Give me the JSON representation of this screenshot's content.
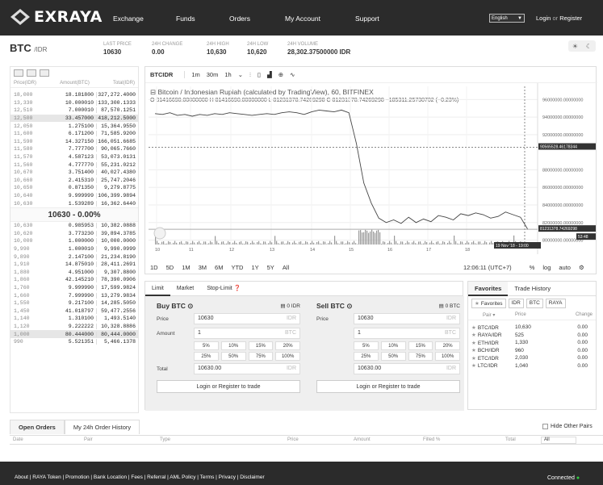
{
  "brand": {
    "name": "EXRAYA"
  },
  "nav": {
    "items": [
      "Exchange",
      "Funds",
      "Orders",
      "My Account",
      "Support"
    ],
    "language": "English",
    "login": "Login",
    "or": "or",
    "register": "Register"
  },
  "ticker": {
    "pair": "BTC",
    "quote": "/IDR",
    "last_label": "LAST PRICE",
    "last": "10630",
    "change_label": "24H CHANGE",
    "change": "0.00",
    "high_label": "24H HIGH",
    "high": "10,630",
    "low_label": "24H LOW",
    "low": "10,620",
    "volume_label": "24H VOLUME",
    "volume": "28,302.37500000 IDR"
  },
  "orderbook": {
    "headers": [
      "Price(IDR)",
      "Amount(BTC)",
      "Total(IDR)"
    ],
    "asks": [
      [
        "18,000",
        "18.181800",
        "327,272.4000"
      ],
      [
        "13,330",
        "10.000010",
        "133,300.1333"
      ],
      [
        "12,510",
        "7.000010",
        "87,570.1251"
      ],
      [
        "12,500",
        "33.457000",
        "418,212.5000"
      ],
      [
        "12,050",
        "1.275100",
        "15,364.9550"
      ],
      [
        "11,600",
        "6.171200",
        "71,585.9200"
      ],
      [
        "11,590",
        "14.327150",
        "166,051.6685"
      ],
      [
        "11,580",
        "7.777700",
        "90,065.7660"
      ],
      [
        "11,570",
        "4.587123",
        "53,073.0131"
      ],
      [
        "11,560",
        "4.777770",
        "55,231.0212"
      ],
      [
        "10,670",
        "3.751400",
        "40,027.4380"
      ],
      [
        "10,660",
        "2.415310",
        "25,747.2046"
      ],
      [
        "10,650",
        "0.871350",
        "9,279.8775"
      ],
      [
        "10,640",
        "9.999999",
        "106,399.9894"
      ],
      [
        "10,630",
        "1.539289",
        "16,362.6440"
      ]
    ],
    "mid": "10630 - 0.00%",
    "bids": [
      [
        "10,630",
        "0.985953",
        "10,382.0888"
      ],
      [
        "10,620",
        "3.773230",
        "39,894.3785"
      ],
      [
        "10,000",
        "1.000000",
        "10,000.0000"
      ],
      [
        "9,990",
        "1.000010",
        "9,990.0999"
      ],
      [
        "9,890",
        "2.147100",
        "21,234.8190"
      ],
      [
        "1,910",
        "14.875010",
        "28,411.2691"
      ],
      [
        "1,880",
        "4.951000",
        "9,307.8800"
      ],
      [
        "1,860",
        "42.145210",
        "78,390.0906"
      ],
      [
        "1,760",
        "9.999990",
        "17,599.9824"
      ],
      [
        "1,660",
        "7.999990",
        "13,279.9834"
      ],
      [
        "1,550",
        "9.217100",
        "14,285.5050"
      ],
      [
        "1,450",
        "41.018797",
        "59,477.2556"
      ],
      [
        "1,140",
        "1.310100",
        "1,493.5140"
      ],
      [
        "1,120",
        "9.222222",
        "10,328.8886"
      ],
      [
        "1,000",
        "80.444000",
        "80,444.0000"
      ],
      [
        "990",
        "5.521351",
        "5,466.1378"
      ]
    ]
  },
  "chart": {
    "pair": "BTCIDR",
    "intervals": [
      "1m",
      "30m",
      "1h"
    ],
    "title": "Bitcoin / Indonesian Rupiah (calculated by TradingView), 60, BITFINEX",
    "ohlc": "O 81416690.00000000  H 81416690.00000000  L 81231378.74269298  C 81231378.74269298  −185311.25730702 (−0.23%)",
    "ranges": [
      "1D",
      "5D",
      "1M",
      "3M",
      "6M",
      "YTD",
      "1Y",
      "5Y",
      "All"
    ],
    "time": "12:06:11 (UTC+7)",
    "pct": "%",
    "log": "log",
    "auto": "auto",
    "x_ticks": [
      "10",
      "11",
      "12",
      "13",
      "14",
      "15",
      "16",
      "17",
      "18"
    ],
    "y_ticks": [
      "96000000.00000000",
      "94000000.00000000",
      "92000000.00000000",
      "88000000.00000000",
      "86000000.00000000",
      "84000000.00000000",
      "82000000.00000000",
      "80000000.00000000"
    ],
    "cross_label": "90565528.46178344",
    "last_label": "81231378.74269298",
    "time_label": "53:48",
    "date_label": "19 Nov '18 - 19:00"
  },
  "chart_data": {
    "type": "line",
    "series": [
      {
        "values": [
          94400000,
          94300000,
          94500000,
          94200000,
          94300000,
          94100000,
          94300000,
          94200000,
          94400000,
          94300000,
          94500000,
          94400000,
          94300000,
          94200000,
          94300000,
          94400000,
          94300000,
          94500000,
          94600000,
          94500000,
          94300000,
          94600000,
          94800000,
          94700000,
          94600000,
          94800000,
          94500000,
          91000000,
          86500000,
          84200000,
          82500000,
          82000000,
          82300000,
          81900000,
          82600000,
          82000000,
          82400000,
          82100000,
          82800000,
          82600000,
          82300000,
          83000000,
          82800000,
          83100000,
          82900000,
          82500000,
          82700000,
          83200000,
          82900000,
          82600000,
          81200000
        ]
      }
    ],
    "ylim": [
      79500000,
      97500000
    ]
  },
  "forms": {
    "tabs": [
      "Limit",
      "Market",
      "Stop-Limit"
    ],
    "buy": {
      "title": "Buy BTC",
      "balance": "0 IDR",
      "price": "10630",
      "amount": "1",
      "total": "10630.00",
      "unit_idr": "IDR",
      "unit_btc": "BTC",
      "pcts": [
        "5%",
        "10%",
        "15%",
        "20%",
        "25%",
        "50%",
        "75%",
        "100%"
      ],
      "btn": "Login or Register to trade"
    },
    "sell": {
      "title": "Sell BTC",
      "balance": "0 BTC",
      "price": "10630",
      "amount": "1",
      "total": "10630.00",
      "unit_idr": "IDR",
      "unit_btc": "BTC",
      "pcts": [
        "5%",
        "10%",
        "15%",
        "20%",
        "25%",
        "50%",
        "75%",
        "100%"
      ],
      "btn": "Login or Register to trade"
    },
    "labels": {
      "price": "Price",
      "amount": "Amount",
      "total": "Total"
    }
  },
  "favorites": {
    "tabs": [
      "Favorites",
      "Trade History"
    ],
    "filters": [
      "Favorites",
      "IDR",
      "BTC",
      "RAYA"
    ],
    "headers": [
      "Pair",
      "Price",
      "Change"
    ],
    "rows": [
      [
        "BTC/IDR",
        "10,630",
        "0.00"
      ],
      [
        "RAYA/IDR",
        "525",
        "0.00"
      ],
      [
        "ETH/IDR",
        "1,330",
        "0.00"
      ],
      [
        "BCH/IDR",
        "960",
        "0.00"
      ],
      [
        "ETC/IDR",
        "2,030",
        "0.00"
      ],
      [
        "LTC/IDR",
        "1,040",
        "0.00"
      ]
    ]
  },
  "orders": {
    "tabs": [
      "Open Orders",
      "My 24h Order History"
    ],
    "hide_other": "Hide Other Pairs",
    "headers": [
      "Date",
      "Pair",
      "Type",
      "Price",
      "Amount",
      "Filled %",
      "Total"
    ],
    "all": "All"
  },
  "footer": {
    "links": "About  |  RAYA Token  |  Promotion  |  Bank Location  |  Fees  |  Referral  |  AML Policy  |  Terms  |  Privacy  |  Disclaimer",
    "status": "Connected"
  },
  "colors": {
    "dark": "#2b2b2b",
    "accent": "#2ecc40"
  }
}
